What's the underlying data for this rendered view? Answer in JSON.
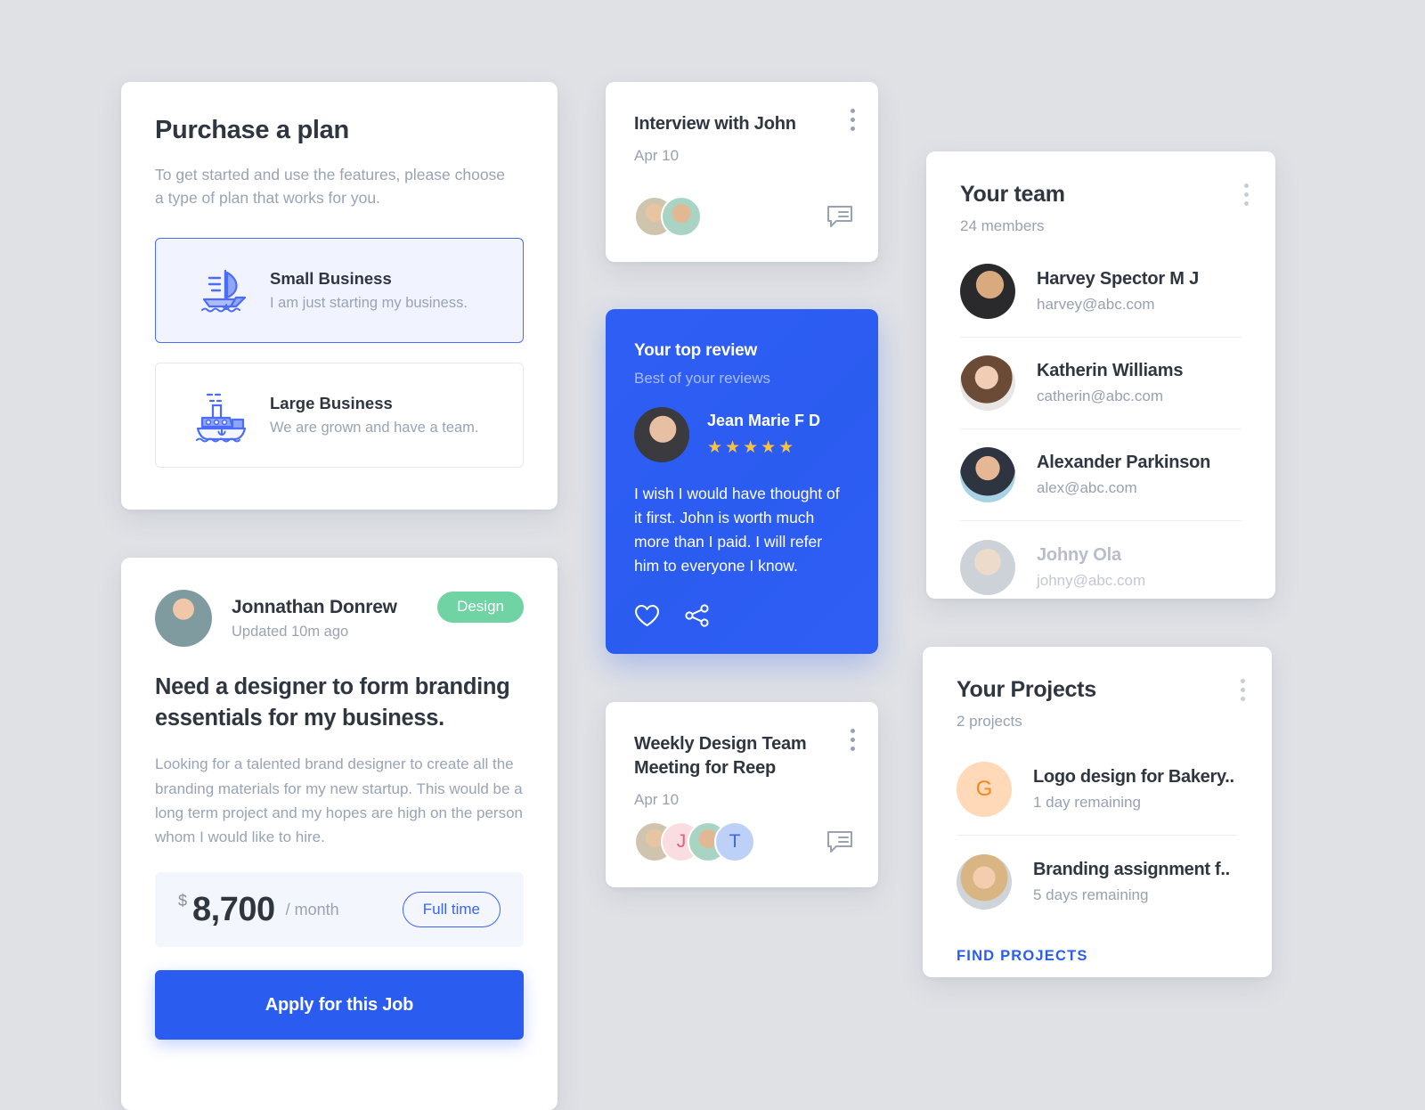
{
  "theme": {
    "background": "#dfe1e5",
    "accent_blue": "#2b5cf0",
    "accent_green": "#6fd3a4",
    "star_yellow": "#f9c23c",
    "muted_text": "#98a1b0",
    "dark_text": "#2f3640"
  },
  "plan_card": {
    "title": "Purchase a plan",
    "subtitle": "To get started and use the features, please choose a type of plan that works for you.",
    "options": [
      {
        "name": "Small Business",
        "description": "I am just starting my business.",
        "icon": "sailboat-icon",
        "selected": true
      },
      {
        "name": "Large Business",
        "description": "We are grown and have a team.",
        "icon": "steamboat-icon",
        "selected": false
      }
    ]
  },
  "job_card": {
    "poster_name": "Jonnathan Donrew",
    "updated": "Updated 10m ago",
    "badge": "Design",
    "title": "Need a designer to form branding essentials for my business.",
    "description": "Looking for a talented brand designer to create all the branding materials for my new startup. This would be a long term project and my hopes are high on the person whom I would like to hire.",
    "currency": "$",
    "amount": "8,700",
    "period": "/ month",
    "job_type": "Full time",
    "apply_label": "Apply for this Job"
  },
  "interview_card": {
    "title": "Interview with John",
    "date": "Apr 10",
    "menu_icon": "more-vertical-icon",
    "chat_icon": "comment-icon",
    "attendees": [
      "avatar-1",
      "avatar-2"
    ]
  },
  "review_card": {
    "title": "Your top review",
    "subtitle": "Best of your reviews",
    "reviewer": "Jean Marie F D",
    "rating": 5,
    "rating_display": "★★★★★",
    "text": "I wish I would have thought of it first. John is worth much more than I paid. I will refer him to everyone I know.",
    "like_icon": "heart-icon",
    "share_icon": "share-icon"
  },
  "weekly_card": {
    "title": "Weekly Design Team Meeting for Reep",
    "date": "Apr 10",
    "menu_icon": "more-vertical-icon",
    "chat_icon": "comment-icon",
    "attendees": [
      {
        "type": "photo"
      },
      {
        "type": "letter",
        "letter": "J"
      },
      {
        "type": "photo"
      },
      {
        "type": "letter",
        "letter": "T"
      }
    ]
  },
  "team_card": {
    "title": "Your team",
    "count": "24 members",
    "menu_icon": "more-vertical-icon",
    "members": [
      {
        "name": "Harvey Spector M J",
        "email": "harvey@abc.com",
        "faded": false
      },
      {
        "name": "Katherin Williams",
        "email": "catherin@abc.com",
        "faded": false
      },
      {
        "name": "Alexander Parkinson",
        "email": "alex@abc.com",
        "faded": false
      },
      {
        "name": "Johny Ola",
        "email": "johny@abc.com",
        "faded": true
      }
    ]
  },
  "projects_card": {
    "title": "Your Projects",
    "count": "2 projects",
    "menu_icon": "more-vertical-icon",
    "projects": [
      {
        "name": "Logo design for Bakery..",
        "time": "1 day remaining",
        "avatar_letter": "G"
      },
      {
        "name": "Branding assignment f..",
        "time": "5 days remaining",
        "avatar_letter": null
      }
    ],
    "find_label": "FIND PROJECTS"
  }
}
